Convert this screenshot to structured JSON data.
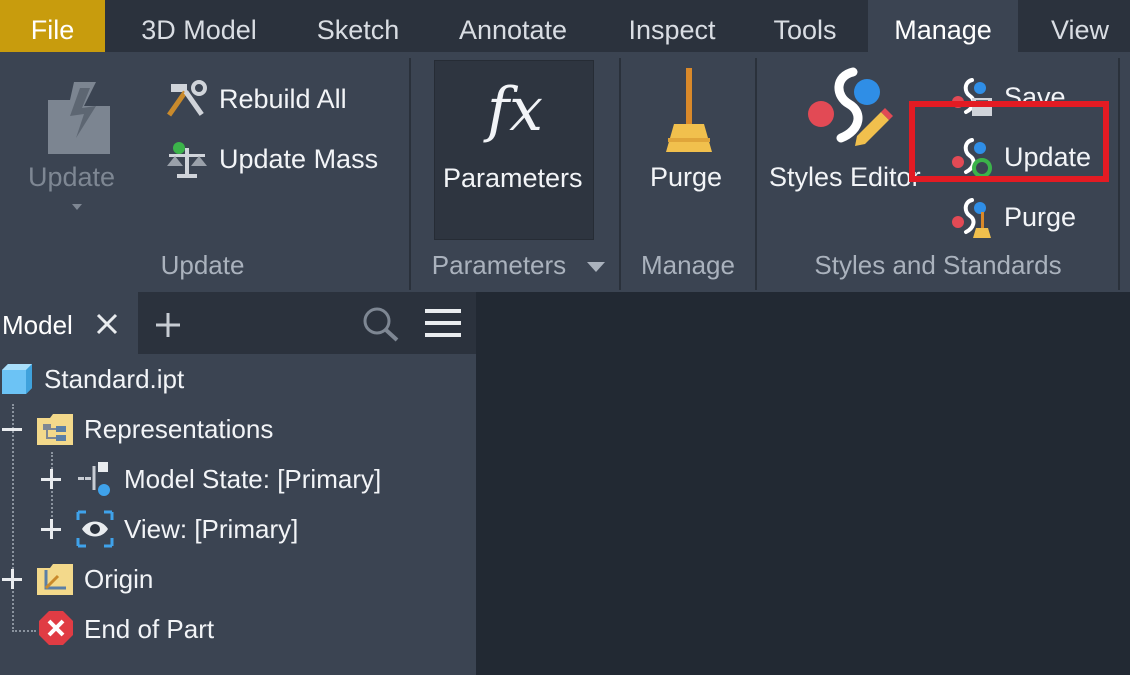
{
  "tabs": [
    {
      "label": "File"
    },
    {
      "label": "3D Model"
    },
    {
      "label": "Sketch"
    },
    {
      "label": "Annotate"
    },
    {
      "label": "Inspect"
    },
    {
      "label": "Tools"
    },
    {
      "label": "Manage",
      "active": true
    },
    {
      "label": "View"
    }
  ],
  "ribbon": {
    "update_panel": {
      "title": "Update",
      "update_button": "Update",
      "rebuild_all": "Rebuild All",
      "update_mass": "Update Mass"
    },
    "parameters_panel": {
      "title": "Parameters",
      "parameters_button": "Parameters",
      "fx_glyph": "fx"
    },
    "manage_panel": {
      "title": "Manage",
      "purge_button": "Purge"
    },
    "styles_panel": {
      "title": "Styles and Standards",
      "styles_editor": "Styles Editor",
      "save": "Save",
      "update": "Update",
      "purge": "Purge"
    }
  },
  "browser": {
    "tab_label": "Model",
    "tree": {
      "root": "Standard.ipt",
      "representations": "Representations",
      "model_state": "Model State: [Primary]",
      "view": "View: [Primary]",
      "origin": "Origin",
      "end_of_part": "End of Part"
    }
  },
  "icons": {
    "close": "close-icon",
    "add": "plus-icon",
    "search": "search-icon",
    "menu": "hamburger-menu-icon"
  },
  "colors": {
    "file_tab": "#c89c0d",
    "ribbon_bg": "#3b4452",
    "highlight": "#e31b23",
    "canvas_bg": "#222933"
  }
}
